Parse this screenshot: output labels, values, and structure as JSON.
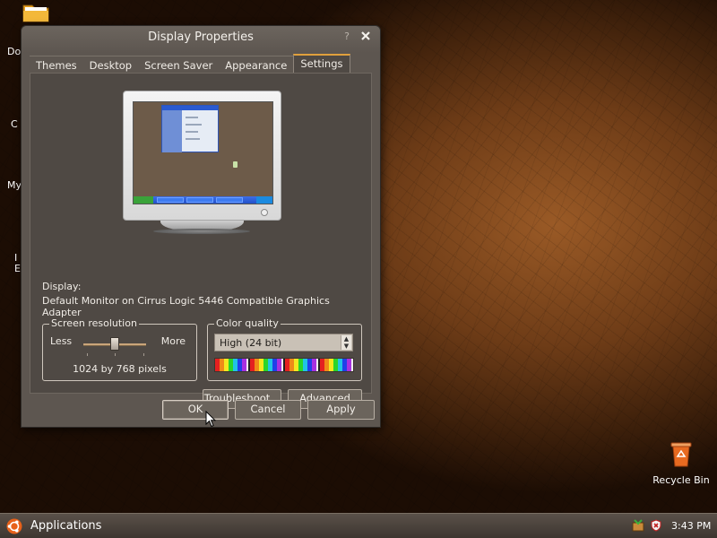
{
  "desktop": {
    "left_labels": [
      "Do",
      "C",
      "My",
      "I",
      "E"
    ],
    "recycle_bin_label": "Recycle Bin"
  },
  "dialog": {
    "title": "Display Properties",
    "help_glyph": "?",
    "tabs": [
      "Themes",
      "Desktop",
      "Screen Saver",
      "Appearance",
      "Settings"
    ],
    "active_tab": "Settings",
    "display_label": "Display:",
    "display_value": "Default Monitor on Cirrus Logic 5446 Compatible Graphics Adapter",
    "screen_resolution": {
      "title": "Screen resolution",
      "less_label": "Less",
      "more_label": "More",
      "value_text": "1024 by 768 pixels"
    },
    "color_quality": {
      "title": "Color quality",
      "selected": "High (24 bit)"
    },
    "buttons": {
      "troubleshoot": "Troubleshoot...",
      "advanced": "Advanced",
      "ok": "OK",
      "cancel": "Cancel",
      "apply": "Apply"
    }
  },
  "taskbar": {
    "applications_label": "Applications",
    "clock": "3:43 PM"
  },
  "colors": {
    "dialog_bg": "#5d5650",
    "active_tab_accent": "#e0a03c",
    "taskbar_bg": "#4a423b"
  }
}
